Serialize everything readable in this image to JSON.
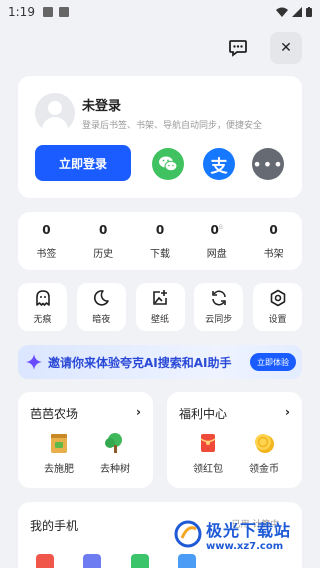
{
  "status_bar": {
    "time": "1:19"
  },
  "login": {
    "title": "未登录",
    "subtitle": "登录后书签、书架、导航自动同步，便捷安全",
    "button": "立即登录"
  },
  "stats": [
    {
      "count": "0",
      "label": "书签"
    },
    {
      "count": "0",
      "label": "历史"
    },
    {
      "count": "0",
      "label": "下载"
    },
    {
      "count": "0",
      "label": "网盘"
    },
    {
      "count": "0",
      "label": "书架"
    }
  ],
  "tools": [
    {
      "label": "无痕",
      "icon": "ghost-icon"
    },
    {
      "label": "暗夜",
      "icon": "moon-icon"
    },
    {
      "label": "壁纸",
      "icon": "wallpaper-icon"
    },
    {
      "label": "云同步",
      "icon": "sync-icon"
    },
    {
      "label": "设置",
      "icon": "gear-icon"
    }
  ],
  "banner": {
    "text": "邀请你来体验夸克AI搜索和AI助手",
    "button": "立即体验"
  },
  "farm": {
    "title": "芭芭农场",
    "items": [
      {
        "label": "去施肥"
      },
      {
        "label": "去种树"
      }
    ]
  },
  "welfare": {
    "title": "福利中心",
    "items": [
      {
        "label": "领红包"
      },
      {
        "label": "领金币"
      }
    ]
  },
  "phone": {
    "title": "我的手机",
    "used": "已用 计算中..."
  },
  "watermark": {
    "name": "极光下载站",
    "url": "www.xz7.com"
  },
  "colors": {
    "accent": "#1a5cff",
    "wechat": "#3fc25f",
    "alipay": "#1677ff",
    "background": "#f0f2f5"
  }
}
